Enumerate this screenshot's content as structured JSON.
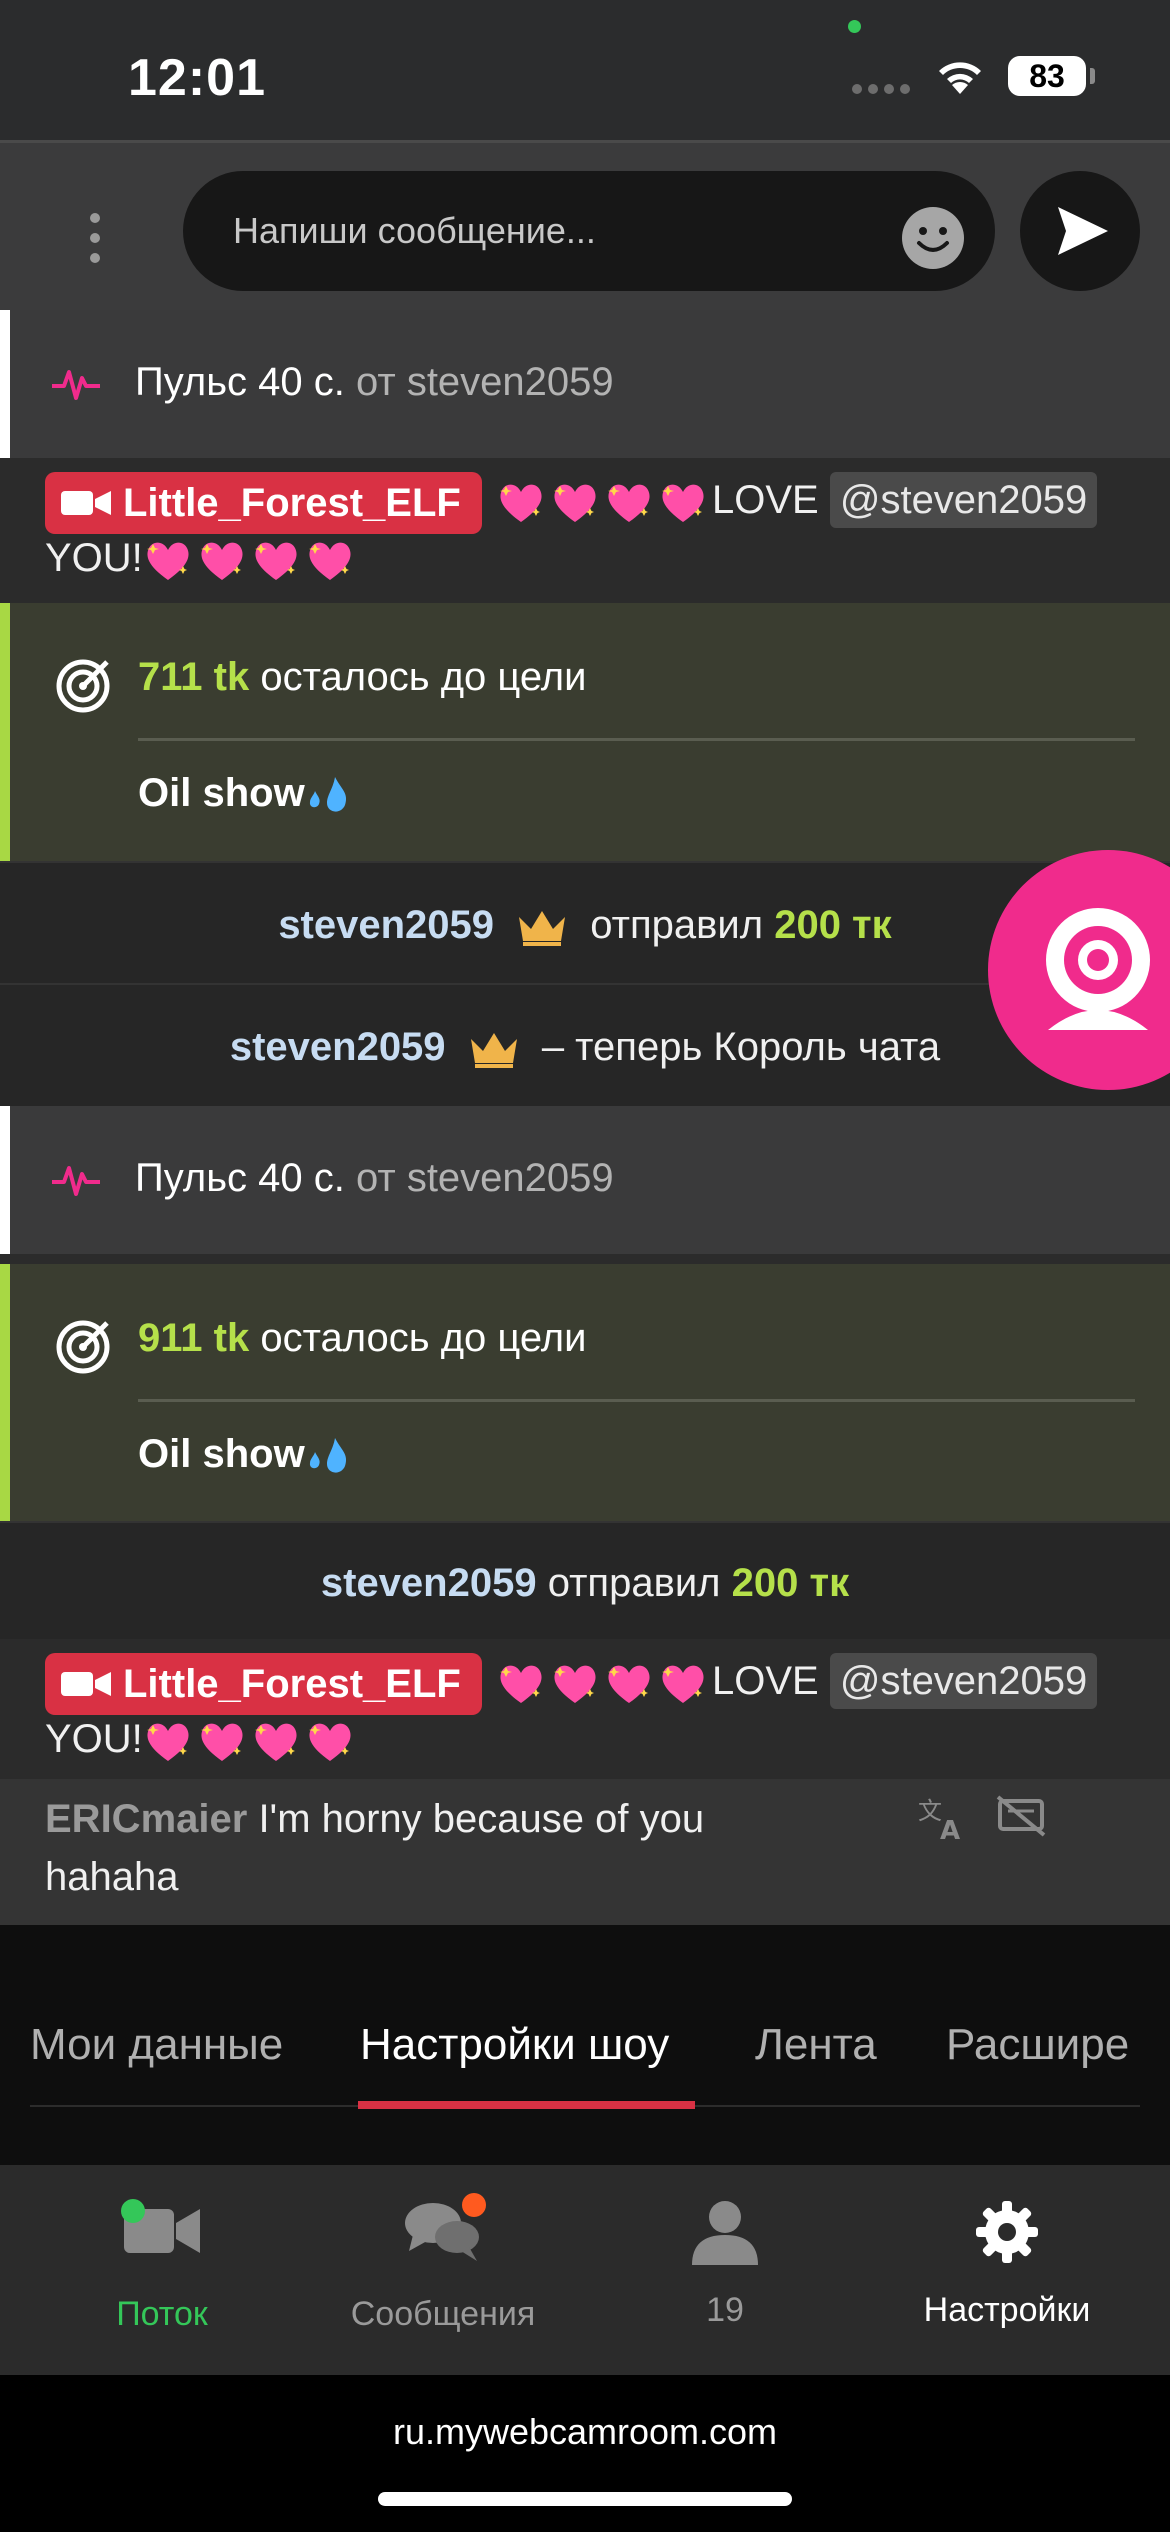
{
  "status_bar": {
    "time": "12:01",
    "battery": "83"
  },
  "composer": {
    "placeholder": "Напиши сообщение..."
  },
  "feed": {
    "pulse_1": {
      "label": "Пульс 40 с.",
      "from": "от steven2059"
    },
    "chat_1": {
      "badge_name": "Little_Forest_ELF",
      "text_a": "LOVE",
      "mention": "@steven2059",
      "text_b": "YOU!"
    },
    "goal_1": {
      "tokens": "711 tk",
      "text": "осталось до цели",
      "name": "Oil show"
    },
    "tip_1": {
      "user": "steven2059",
      "action": "отправил",
      "amount": "200 тк"
    },
    "king_1": {
      "user": "steven2059",
      "text": "– теперь Король чата"
    },
    "pulse_2": {
      "label": "Пульс 40 с.",
      "from": "от steven2059"
    },
    "goal_2": {
      "tokens": "911 tk",
      "text": "осталось до цели",
      "name": "Oil show"
    },
    "tip_2": {
      "user": "steven2059",
      "action": "отправил",
      "amount": "200 тк"
    },
    "chat_2": {
      "badge_name": "Little_Forest_ELF",
      "text_a": "LOVE",
      "mention": "@steven2059",
      "text_b": "YOU!"
    },
    "chat_3": {
      "user": "ERICmaier",
      "line_1": "I'm horny because of you",
      "line_2": "hahaha"
    }
  },
  "tabs": [
    "Мои данные",
    "Настройки шоу",
    "Лента",
    "Расшире"
  ],
  "bottom_nav": [
    {
      "label": "Поток",
      "icon": "camera-icon"
    },
    {
      "label": "Сообщения",
      "icon": "chat-bubbles-icon"
    },
    {
      "label": "19",
      "icon": "person-icon"
    },
    {
      "label": "Настройки",
      "icon": "gear-icon"
    }
  ],
  "url": "ru.mywebcamroom.com",
  "colors": {
    "accent_red": "#d93144",
    "token_green": "#b5e04a",
    "pulse_pink": "#f02b8c",
    "online_green": "#34c759"
  }
}
